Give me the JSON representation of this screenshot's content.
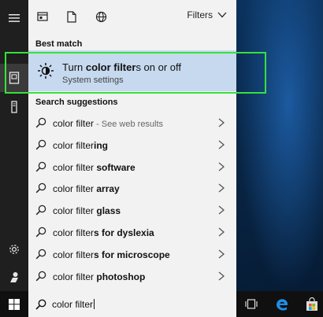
{
  "panel": {
    "filters_label": "Filters",
    "best_match_heading": "Best match",
    "suggestions_heading": "Search suggestions"
  },
  "best_match": {
    "title_parts": [
      {
        "text": "Turn ",
        "bold": false
      },
      {
        "text": "color filter",
        "bold": true
      },
      {
        "text": "s on or off",
        "bold": false
      }
    ],
    "subtitle": "System settings"
  },
  "suggestions": [
    {
      "parts": [
        {
          "text": "color filter",
          "bold": false
        },
        {
          "text": " - See web results",
          "muted": true
        }
      ]
    },
    {
      "parts": [
        {
          "text": "color filter",
          "bold": false
        },
        {
          "text": "ing",
          "bold": true
        }
      ]
    },
    {
      "parts": [
        {
          "text": "color filter ",
          "bold": false
        },
        {
          "text": "software",
          "bold": true
        }
      ]
    },
    {
      "parts": [
        {
          "text": "color filter ",
          "bold": false
        },
        {
          "text": "array",
          "bold": true
        }
      ]
    },
    {
      "parts": [
        {
          "text": "color filter ",
          "bold": false
        },
        {
          "text": "glass",
          "bold": true
        }
      ]
    },
    {
      "parts": [
        {
          "text": "color filter",
          "bold": false
        },
        {
          "text": "s for dyslexia",
          "bold": true
        }
      ]
    },
    {
      "parts": [
        {
          "text": "color filter",
          "bold": false
        },
        {
          "text": "s for microscope",
          "bold": true
        }
      ]
    },
    {
      "parts": [
        {
          "text": "color filter ",
          "bold": false
        },
        {
          "text": "photoshop",
          "bold": true
        }
      ]
    }
  ],
  "search": {
    "query": "color filter"
  },
  "colors": {
    "highlight_border": "#35e23b",
    "best_match_bg": "#c6d9ef",
    "rail_bg": "#1f1f1f",
    "edge_blue": "#1e8fe6"
  },
  "icons": {
    "rail": [
      "hamburger-icon",
      "documents-icon",
      "tower-icon",
      "settings-gear-icon",
      "person-icon"
    ],
    "top": [
      "apps-icon",
      "document-icon",
      "globe-icon"
    ],
    "taskbar": [
      "windows-logo-icon",
      "task-view-icon",
      "edge-icon",
      "store-icon"
    ]
  }
}
